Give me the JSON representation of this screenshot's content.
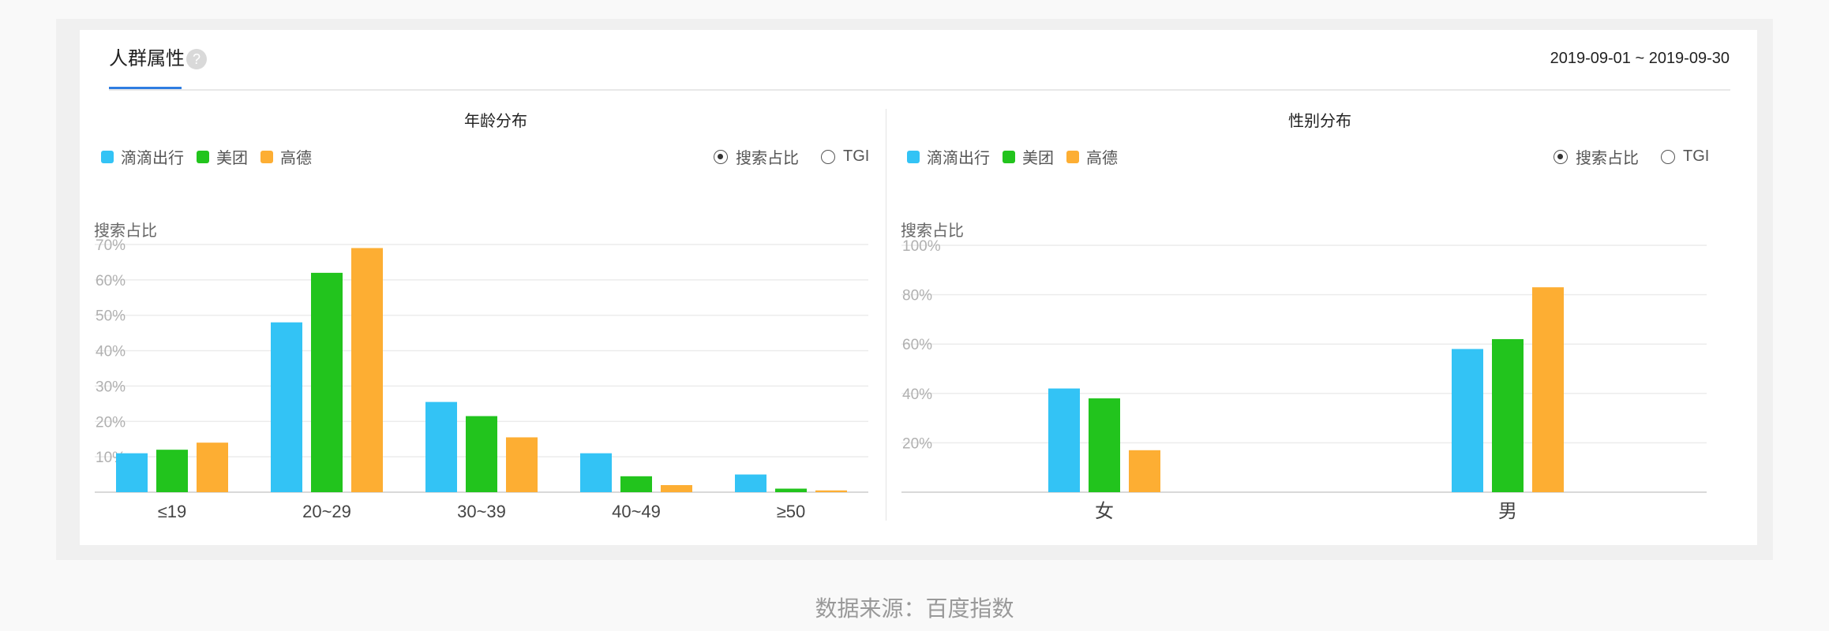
{
  "header": {
    "title": "人群属性",
    "help_glyph": "?",
    "date_range": "2019-09-01 ~ 2019-09-30"
  },
  "colors": {
    "滴滴出行": "#33c3f5",
    "美团": "#22c41d",
    "高德": "#fdae33"
  },
  "radio_options": [
    {
      "label": "搜索占比",
      "selected": true
    },
    {
      "label": "TGI",
      "selected": false
    }
  ],
  "chart_data": [
    {
      "type": "bar",
      "title": "年龄分布",
      "ylabel": "搜索占比",
      "categories": [
        "≤19",
        "20~29",
        "30~39",
        "40~49",
        "≥50"
      ],
      "yticks": [
        "10%",
        "20%",
        "30%",
        "40%",
        "50%",
        "60%",
        "70%"
      ],
      "ylim": [
        0,
        70
      ],
      "series": [
        {
          "name": "滴滴出行",
          "values": [
            11,
            48,
            25.5,
            11,
            5
          ]
        },
        {
          "name": "美团",
          "values": [
            12,
            62,
            21.5,
            4.5,
            1
          ]
        },
        {
          "name": "高德",
          "values": [
            14,
            69,
            15.5,
            2,
            0.5
          ]
        }
      ],
      "legend": "top-left",
      "grid": true
    },
    {
      "type": "bar",
      "title": "性别分布",
      "ylabel": "搜索占比",
      "categories": [
        "女",
        "男"
      ],
      "yticks": [
        "20%",
        "40%",
        "60%",
        "80%",
        "100%"
      ],
      "ylim": [
        0,
        100
      ],
      "series": [
        {
          "name": "滴滴出行",
          "values": [
            42,
            58
          ]
        },
        {
          "name": "美团",
          "values": [
            38,
            62
          ]
        },
        {
          "name": "高德",
          "values": [
            17,
            83
          ]
        }
      ],
      "legend": "top-left",
      "grid": true
    }
  ],
  "footer": {
    "source": "数据来源：百度指数"
  }
}
